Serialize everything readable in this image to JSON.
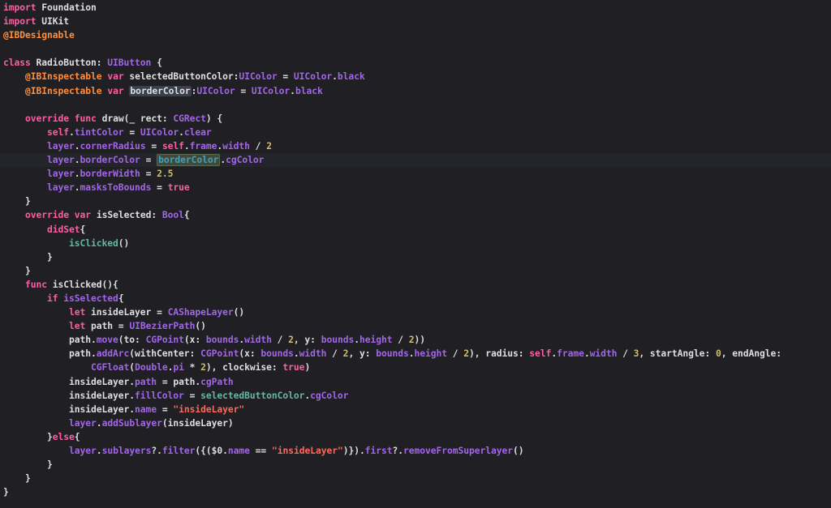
{
  "editor": {
    "language": "Swift",
    "current_line": 11,
    "highlighted_symbol": "borderColor",
    "colors": {
      "background": "#1f1f24",
      "current_line": "#23252b",
      "plain_text": "#dfdfe0",
      "keyword": "#fc5fa3",
      "attribute": "#fd8f3f",
      "type": "#5dd8ff",
      "library_member": "#a167e6",
      "number": "#d0bf69",
      "string": "#fc6a5d"
    },
    "lines": [
      [
        {
          "t": "import",
          "c": "kw"
        },
        {
          "t": " Foundation"
        }
      ],
      [
        {
          "t": "import",
          "c": "kw"
        },
        {
          "t": " UIKit"
        }
      ],
      [
        {
          "t": "@IBDesignable",
          "c": "attr"
        }
      ],
      [],
      [
        {
          "t": "class",
          "c": "kw"
        },
        {
          "t": " RadioButton: "
        },
        {
          "t": "UIButton",
          "c": "lib"
        },
        {
          "t": " {"
        }
      ],
      [
        {
          "t": "    "
        },
        {
          "t": "@IBInspectable",
          "c": "attr"
        },
        {
          "t": " "
        },
        {
          "t": "var",
          "c": "kw"
        },
        {
          "t": " selectedButtonColor:"
        },
        {
          "t": "UIColor",
          "c": "lib"
        },
        {
          "t": " = "
        },
        {
          "t": "UIColor",
          "c": "lib"
        },
        {
          "t": "."
        },
        {
          "t": "black",
          "c": "lib"
        }
      ],
      [
        {
          "t": "    "
        },
        {
          "t": "@IBInspectable",
          "c": "attr"
        },
        {
          "t": " "
        },
        {
          "t": "var",
          "c": "kw"
        },
        {
          "t": " "
        },
        {
          "t": "borderColor",
          "c": "fn",
          "hl": "name"
        },
        {
          "t": ":"
        },
        {
          "t": "UIColor",
          "c": "lib"
        },
        {
          "t": " = "
        },
        {
          "t": "UIColor",
          "c": "lib"
        },
        {
          "t": "."
        },
        {
          "t": "black",
          "c": "lib"
        }
      ],
      [],
      [
        {
          "t": "    "
        },
        {
          "t": "override",
          "c": "kw"
        },
        {
          "t": " "
        },
        {
          "t": "func",
          "c": "kw"
        },
        {
          "t": " draw(_ rect: "
        },
        {
          "t": "CGRect",
          "c": "lib"
        },
        {
          "t": ") {"
        }
      ],
      [
        {
          "t": "        "
        },
        {
          "t": "self",
          "c": "kw"
        },
        {
          "t": "."
        },
        {
          "t": "tintColor",
          "c": "lib"
        },
        {
          "t": " = "
        },
        {
          "t": "UIColor",
          "c": "lib"
        },
        {
          "t": "."
        },
        {
          "t": "clear",
          "c": "lib"
        }
      ],
      [
        {
          "t": "        "
        },
        {
          "t": "layer",
          "c": "lib"
        },
        {
          "t": "."
        },
        {
          "t": "cornerRadius",
          "c": "lib"
        },
        {
          "t": " = "
        },
        {
          "t": "self",
          "c": "kw"
        },
        {
          "t": "."
        },
        {
          "t": "frame",
          "c": "lib"
        },
        {
          "t": "."
        },
        {
          "t": "width",
          "c": "lib"
        },
        {
          "t": " / "
        },
        {
          "t": "2",
          "c": "num"
        }
      ],
      [
        {
          "t": "        "
        },
        {
          "t": "layer",
          "c": "lib"
        },
        {
          "t": "."
        },
        {
          "t": "borderColor",
          "c": "lib"
        },
        {
          "t": " = "
        },
        {
          "t": "borderColor",
          "c": "user",
          "hl": "use"
        },
        {
          "t": "."
        },
        {
          "t": "cgColor",
          "c": "lib"
        }
      ],
      [
        {
          "t": "        "
        },
        {
          "t": "layer",
          "c": "lib"
        },
        {
          "t": "."
        },
        {
          "t": "borderWidth",
          "c": "lib"
        },
        {
          "t": " = "
        },
        {
          "t": "2.5",
          "c": "num"
        }
      ],
      [
        {
          "t": "        "
        },
        {
          "t": "layer",
          "c": "lib"
        },
        {
          "t": "."
        },
        {
          "t": "masksToBounds",
          "c": "lib"
        },
        {
          "t": " = "
        },
        {
          "t": "true",
          "c": "kw"
        }
      ],
      [
        {
          "t": "    }"
        }
      ],
      [
        {
          "t": "    "
        },
        {
          "t": "override",
          "c": "kw"
        },
        {
          "t": " "
        },
        {
          "t": "var",
          "c": "kw"
        },
        {
          "t": " isSelected: "
        },
        {
          "t": "Bool",
          "c": "lib"
        },
        {
          "t": "{"
        }
      ],
      [
        {
          "t": "        "
        },
        {
          "t": "didSet",
          "c": "kw"
        },
        {
          "t": "{"
        }
      ],
      [
        {
          "t": "            "
        },
        {
          "t": "isClicked",
          "c": "prop"
        },
        {
          "t": "()"
        }
      ],
      [
        {
          "t": "        }"
        }
      ],
      [
        {
          "t": "    }"
        }
      ],
      [
        {
          "t": "    "
        },
        {
          "t": "func",
          "c": "kw"
        },
        {
          "t": " isClicked(){"
        }
      ],
      [
        {
          "t": "        "
        },
        {
          "t": "if",
          "c": "kw"
        },
        {
          "t": " "
        },
        {
          "t": "isSelected",
          "c": "lib"
        },
        {
          "t": "{"
        }
      ],
      [
        {
          "t": "            "
        },
        {
          "t": "let",
          "c": "kw"
        },
        {
          "t": " insideLayer = "
        },
        {
          "t": "CAShapeLayer",
          "c": "lib"
        },
        {
          "t": "()"
        }
      ],
      [
        {
          "t": "            "
        },
        {
          "t": "let",
          "c": "kw"
        },
        {
          "t": " path = "
        },
        {
          "t": "UIBezierPath",
          "c": "lib"
        },
        {
          "t": "()"
        }
      ],
      [
        {
          "t": "            path."
        },
        {
          "t": "move",
          "c": "lib"
        },
        {
          "t": "(to: "
        },
        {
          "t": "CGPoint",
          "c": "lib"
        },
        {
          "t": "(x: "
        },
        {
          "t": "bounds",
          "c": "lib"
        },
        {
          "t": "."
        },
        {
          "t": "width",
          "c": "lib"
        },
        {
          "t": " / "
        },
        {
          "t": "2",
          "c": "num"
        },
        {
          "t": ", y: "
        },
        {
          "t": "bounds",
          "c": "lib"
        },
        {
          "t": "."
        },
        {
          "t": "height",
          "c": "lib"
        },
        {
          "t": " / "
        },
        {
          "t": "2",
          "c": "num"
        },
        {
          "t": "))"
        }
      ],
      [
        {
          "t": "            path."
        },
        {
          "t": "addArc",
          "c": "lib"
        },
        {
          "t": "(withCenter: "
        },
        {
          "t": "CGPoint",
          "c": "lib"
        },
        {
          "t": "(x: "
        },
        {
          "t": "bounds",
          "c": "lib"
        },
        {
          "t": "."
        },
        {
          "t": "width",
          "c": "lib"
        },
        {
          "t": " / "
        },
        {
          "t": "2",
          "c": "num"
        },
        {
          "t": ", y: "
        },
        {
          "t": "bounds",
          "c": "lib"
        },
        {
          "t": "."
        },
        {
          "t": "height",
          "c": "lib"
        },
        {
          "t": " / "
        },
        {
          "t": "2",
          "c": "num"
        },
        {
          "t": "), radius: "
        },
        {
          "t": "self",
          "c": "kw"
        },
        {
          "t": "."
        },
        {
          "t": "frame",
          "c": "lib"
        },
        {
          "t": "."
        },
        {
          "t": "width",
          "c": "lib"
        },
        {
          "t": " / "
        },
        {
          "t": "3",
          "c": "num"
        },
        {
          "t": ", startAngle: "
        },
        {
          "t": "0",
          "c": "num"
        },
        {
          "t": ", endAngle:"
        }
      ],
      [
        {
          "t": "                "
        },
        {
          "t": "CGFloat",
          "c": "lib"
        },
        {
          "t": "("
        },
        {
          "t": "Double",
          "c": "lib"
        },
        {
          "t": "."
        },
        {
          "t": "pi",
          "c": "lib"
        },
        {
          "t": " * "
        },
        {
          "t": "2",
          "c": "num"
        },
        {
          "t": "), clockwise: "
        },
        {
          "t": "true",
          "c": "kw"
        },
        {
          "t": ")"
        }
      ],
      [
        {
          "t": "            insideLayer."
        },
        {
          "t": "path",
          "c": "lib"
        },
        {
          "t": " = path."
        },
        {
          "t": "cgPath",
          "c": "lib"
        }
      ],
      [
        {
          "t": "            insideLayer."
        },
        {
          "t": "fillColor",
          "c": "lib"
        },
        {
          "t": " = "
        },
        {
          "t": "selectedButtonColor",
          "c": "prop"
        },
        {
          "t": "."
        },
        {
          "t": "cgColor",
          "c": "lib"
        }
      ],
      [
        {
          "t": "            insideLayer."
        },
        {
          "t": "name",
          "c": "lib"
        },
        {
          "t": " = "
        },
        {
          "t": "\"insideLayer\"",
          "c": "str"
        }
      ],
      [
        {
          "t": "            "
        },
        {
          "t": "layer",
          "c": "lib"
        },
        {
          "t": "."
        },
        {
          "t": "addSublayer",
          "c": "lib"
        },
        {
          "t": "(insideLayer)"
        }
      ],
      [
        {
          "t": "        }"
        },
        {
          "t": "else",
          "c": "kw"
        },
        {
          "t": "{"
        }
      ],
      [
        {
          "t": "            "
        },
        {
          "t": "layer",
          "c": "lib"
        },
        {
          "t": "."
        },
        {
          "t": "sublayers",
          "c": "lib"
        },
        {
          "t": "?."
        },
        {
          "t": "filter",
          "c": "lib"
        },
        {
          "t": "({("
        },
        {
          "t": "$0",
          "c": "fn"
        },
        {
          "t": "."
        },
        {
          "t": "name",
          "c": "lib"
        },
        {
          "t": " == "
        },
        {
          "t": "\"insideLayer\"",
          "c": "str"
        },
        {
          "t": ")})."
        },
        {
          "t": "first",
          "c": "lib"
        },
        {
          "t": "?."
        },
        {
          "t": "removeFromSuperlayer",
          "c": "lib"
        },
        {
          "t": "()"
        }
      ],
      [
        {
          "t": "        }"
        }
      ],
      [
        {
          "t": "    }"
        }
      ],
      [
        {
          "t": "}"
        }
      ]
    ]
  }
}
